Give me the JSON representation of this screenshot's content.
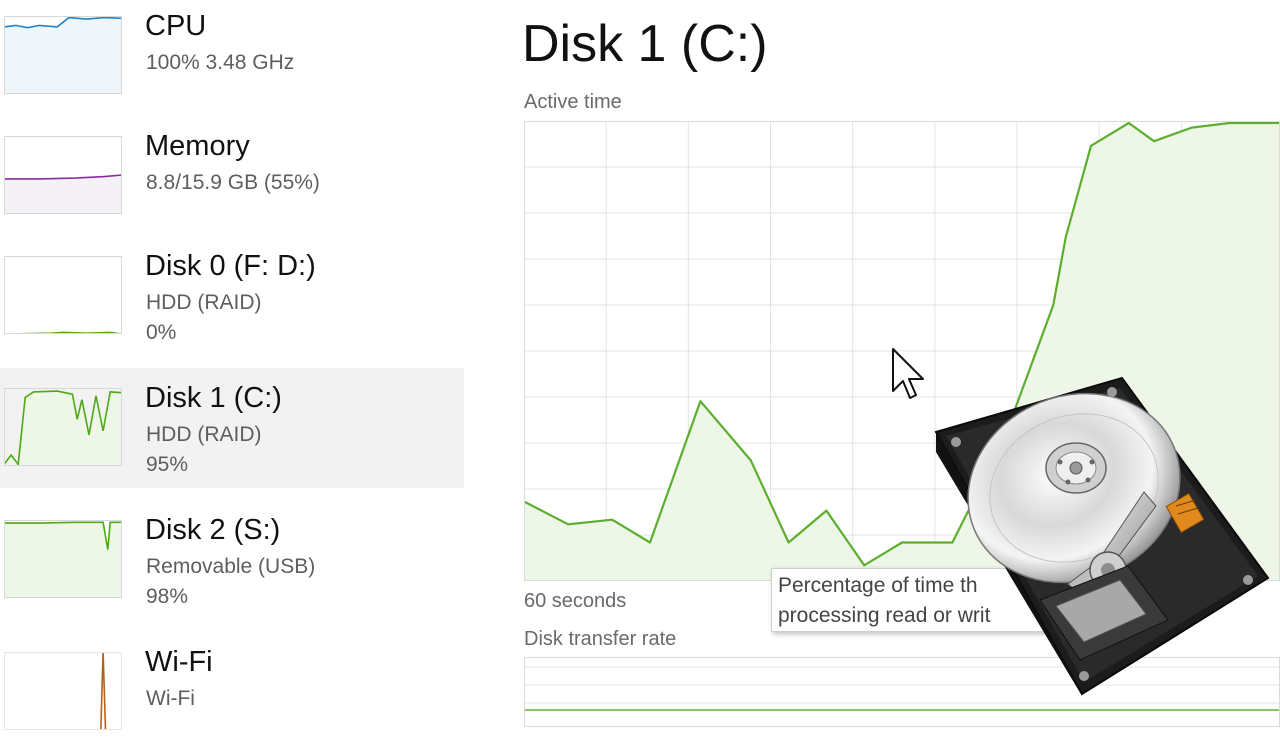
{
  "sidebar": {
    "devices": [
      {
        "name": "CPU",
        "sub1": "100% 3.48 GHz",
        "sub2": "",
        "selected": false,
        "color": "#1f83c8",
        "fill": "#eef5fb",
        "utilization_percent": 100
      },
      {
        "name": "Memory",
        "sub1": "8.8/15.9 GB (55%)",
        "sub2": "",
        "selected": false,
        "color": "#8b2c9e",
        "fill": "#f4f2f6",
        "utilization_percent": 55
      },
      {
        "name": "Disk 0 (F: D:)",
        "sub1": "HDD (RAID)",
        "sub2": "0%",
        "selected": false,
        "color": "#4caa17",
        "fill": "#f3f9ee",
        "utilization_percent": 0
      },
      {
        "name": "Disk 1 (C:)",
        "sub1": "HDD (RAID)",
        "sub2": "95%",
        "selected": true,
        "color": "#4caa17",
        "fill": "#eef6e8",
        "utilization_percent": 95
      },
      {
        "name": "Disk 2 (S:)",
        "sub1": "Removable (USB)",
        "sub2": "98%",
        "selected": false,
        "color": "#4caa17",
        "fill": "#eef6e8",
        "utilization_percent": 98
      },
      {
        "name": "Wi-Fi",
        "sub1": "Wi-Fi",
        "sub2": "",
        "selected": false,
        "color": "#b3621a",
        "fill": "#ffffff",
        "utilization_percent": null
      }
    ]
  },
  "main": {
    "title": "Disk 1 (C:)",
    "active_time_label": "Active time",
    "time_span_label": "60 seconds",
    "transfer_rate_label": "Disk transfer rate",
    "tooltip_line1": "Percentage of time th",
    "tooltip_line2": "processing read or writ"
  },
  "colors": {
    "graph_line": "#5cae2e",
    "graph_fill": "#eef6e8",
    "graph_grid": "#e3e3e3",
    "selected_bg": "#f2f2f2"
  },
  "chart_data": {
    "type": "area",
    "title": "",
    "xlabel": "60 seconds",
    "ylabel": "Active time",
    "ylim": [
      0,
      100
    ],
    "grid": true,
    "x": [
      0,
      3.5,
      7,
      10,
      14,
      18,
      21,
      24,
      27,
      30,
      34,
      38,
      42,
      43,
      45,
      48,
      50,
      53,
      56,
      60
    ],
    "series": [
      {
        "values": [
          17,
          12,
          13,
          8,
          39,
          26,
          8,
          15,
          3,
          8,
          8,
          30,
          60,
          75,
          95,
          100,
          96,
          99,
          100,
          100
        ]
      }
    ]
  }
}
